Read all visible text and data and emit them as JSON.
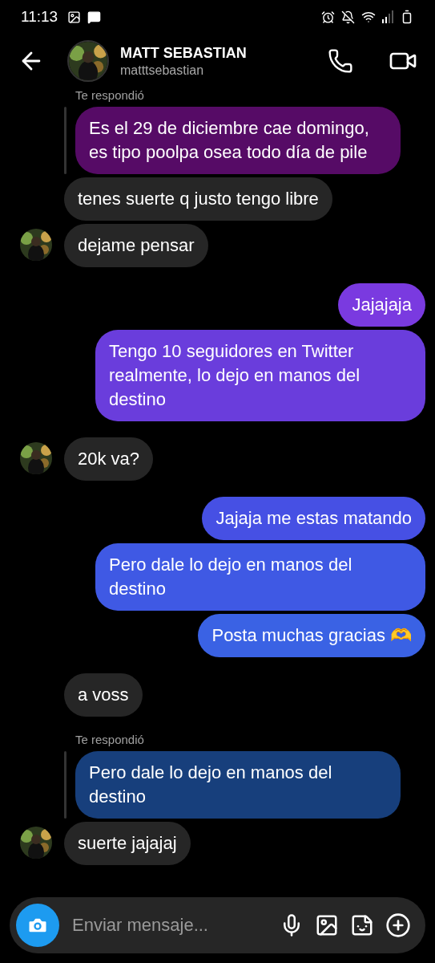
{
  "status_bar": {
    "time": "11:13"
  },
  "header": {
    "name": "MATT SEBASTIAN",
    "username": "matttsebastian"
  },
  "messages": [
    {
      "kind": "reply",
      "label": "Te respondió",
      "text": "Es el 29 de diciembre cae domingo, es tipo poolpa osea todo día de pile",
      "color": "#560b66"
    },
    {
      "kind": "incoming",
      "text": "tenes suerte q justo tengo libre",
      "avatar": false
    },
    {
      "kind": "incoming",
      "text": "dejame pensar",
      "avatar": true
    },
    {
      "kind": "outgoing",
      "text": "Jajajaja",
      "color": "#7a3ae0"
    },
    {
      "kind": "outgoing",
      "text": "Tengo 10 seguidores en Twitter realmente, lo dejo en manos del destino",
      "color": "#6a3ddc"
    },
    {
      "kind": "incoming",
      "text": "20k va?",
      "avatar": true
    },
    {
      "kind": "outgoing",
      "text": "Jajaja me estas matando",
      "color": "#4650e4"
    },
    {
      "kind": "outgoing",
      "text": "Pero dale lo dejo en manos del destino",
      "color": "#3f59e4"
    },
    {
      "kind": "outgoing",
      "text": "Posta muchas gracias 🫶",
      "color": "#3a62e4"
    },
    {
      "kind": "incoming",
      "text": "a voss",
      "avatar": false
    },
    {
      "kind": "reply",
      "label": "Te respondió",
      "text": "Pero dale lo dejo en manos del destino",
      "color": "#173f7c"
    },
    {
      "kind": "incoming",
      "text": "suerte jajajaj",
      "avatar": true
    }
  ],
  "composer": {
    "placeholder": "Enviar mensaje..."
  }
}
